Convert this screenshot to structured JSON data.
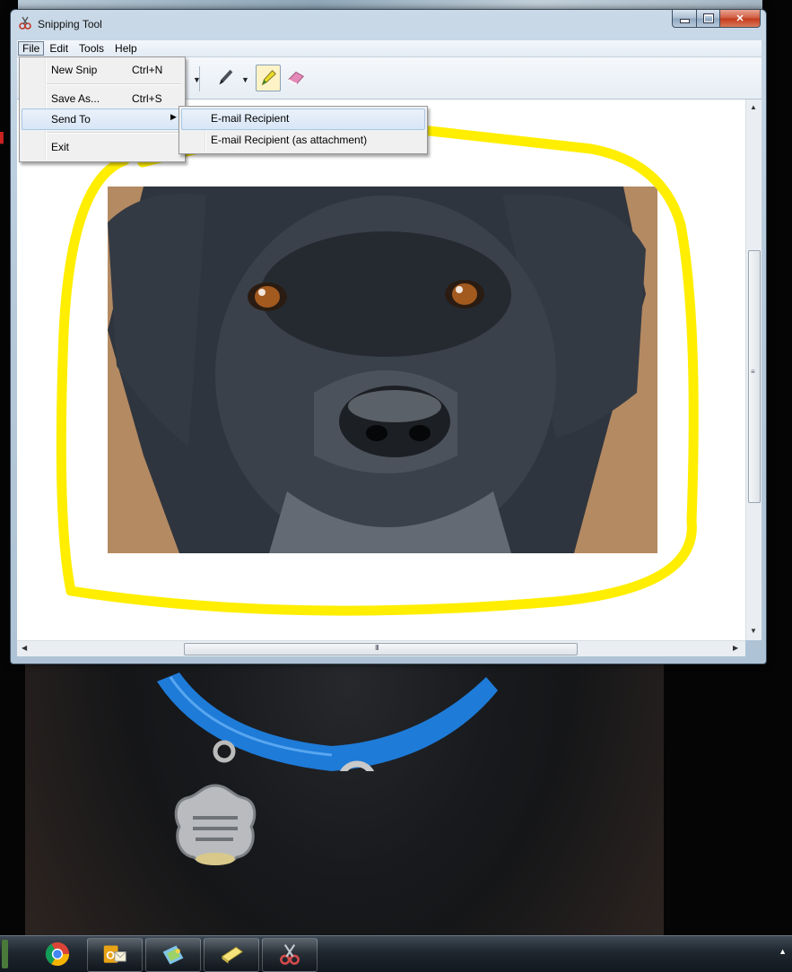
{
  "window": {
    "title": "Snipping Tool",
    "controls": {
      "minimize": "—",
      "maximize": "□",
      "close": "✕"
    }
  },
  "menubar": {
    "items": [
      "File",
      "Edit",
      "Tools",
      "Help"
    ]
  },
  "file_menu": {
    "items": [
      {
        "label": "New Snip",
        "shortcut": "Ctrl+N"
      },
      {
        "label": "Save As...",
        "shortcut": "Ctrl+S"
      },
      {
        "label": "Send To",
        "submenu_arrow": "▶"
      },
      {
        "label": "Exit"
      }
    ]
  },
  "send_to_menu": {
    "items": [
      {
        "label": "E-mail Recipient"
      },
      {
        "label": "E-mail Recipient (as attachment)"
      }
    ]
  },
  "toolbar": {
    "tools": [
      "pen-icon",
      "highlighter-icon",
      "eraser-icon"
    ],
    "active_tool": "highlighter-icon"
  },
  "scrollbars": {
    "up_arrow": "▲",
    "down_arrow": "▼",
    "left_arrow": "◀",
    "right_arrow": "▶",
    "grip": "III"
  },
  "colors": {
    "highlighter": "#ffee00",
    "menu_hover": "#d8e6f6",
    "collar": "#1e7bd8"
  },
  "taskbar": {
    "apps": [
      "chrome-icon",
      "outlook-icon",
      "paint-icon",
      "sticky-notes-icon",
      "snipping-tool-icon"
    ],
    "tray_arrow": "▲"
  }
}
